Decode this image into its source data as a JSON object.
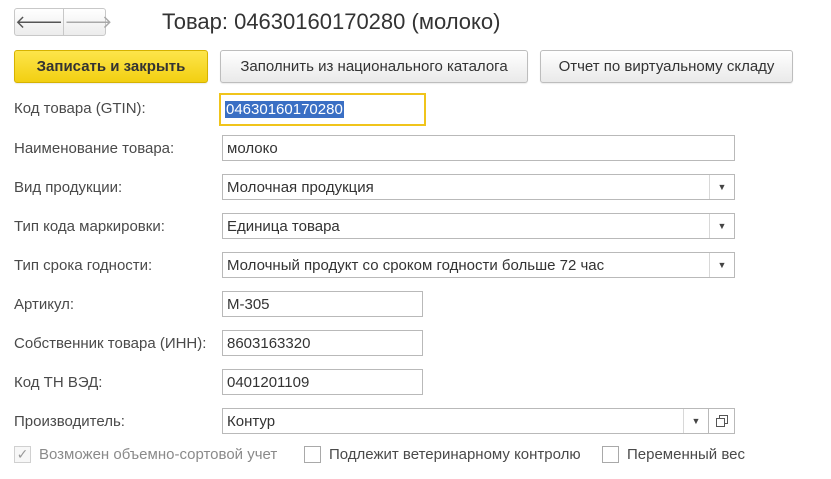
{
  "nav": {
    "back_icon": "arrow-left-icon",
    "forward_icon": "arrow-right-icon",
    "back_glyph": "🡐",
    "forward_glyph": "🡒"
  },
  "title": "Товар: 04630160170280 (молоко)",
  "toolbar": {
    "save_close_label": "Записать и закрыть",
    "fill_catalog_label": "Заполнить из национального каталога",
    "virtual_report_label": "Отчет по виртуальному складу"
  },
  "form": {
    "gtin": {
      "label": "Код товара (GTIN):",
      "value": "04630160170280"
    },
    "name": {
      "label": "Наименование товара:",
      "value": "молоко"
    },
    "product_type": {
      "label": "Вид продукции:",
      "value": "Молочная продукция"
    },
    "marking_code_type": {
      "label": "Тип кода маркировки:",
      "value": "Единица товара"
    },
    "shelf_life_type": {
      "label": "Тип срока годности:",
      "value": "Молочный продукт со сроком годности больше 72 час"
    },
    "article": {
      "label": "Артикул:",
      "value": "М-305"
    },
    "owner_inn": {
      "label": "Собственник товара (ИНН):",
      "value": "8603163320"
    },
    "tnved": {
      "label": "Код ТН ВЭД:",
      "value": "0401201109"
    },
    "manufacturer": {
      "label": "Производитель:",
      "value": "Контур"
    }
  },
  "checkboxes": {
    "volume_sort": {
      "label": "Возможен объемно-сортовой учет",
      "checked": true,
      "disabled": true
    },
    "vet_control": {
      "label": "Подлежит ветеринарному контролю",
      "checked": false
    },
    "variable_weight": {
      "label": "Переменный вес",
      "checked": false
    }
  },
  "colors": {
    "primary_button": "#f5d31c",
    "focus_border": "#f0c41b",
    "selection": "#3a6fc4"
  }
}
